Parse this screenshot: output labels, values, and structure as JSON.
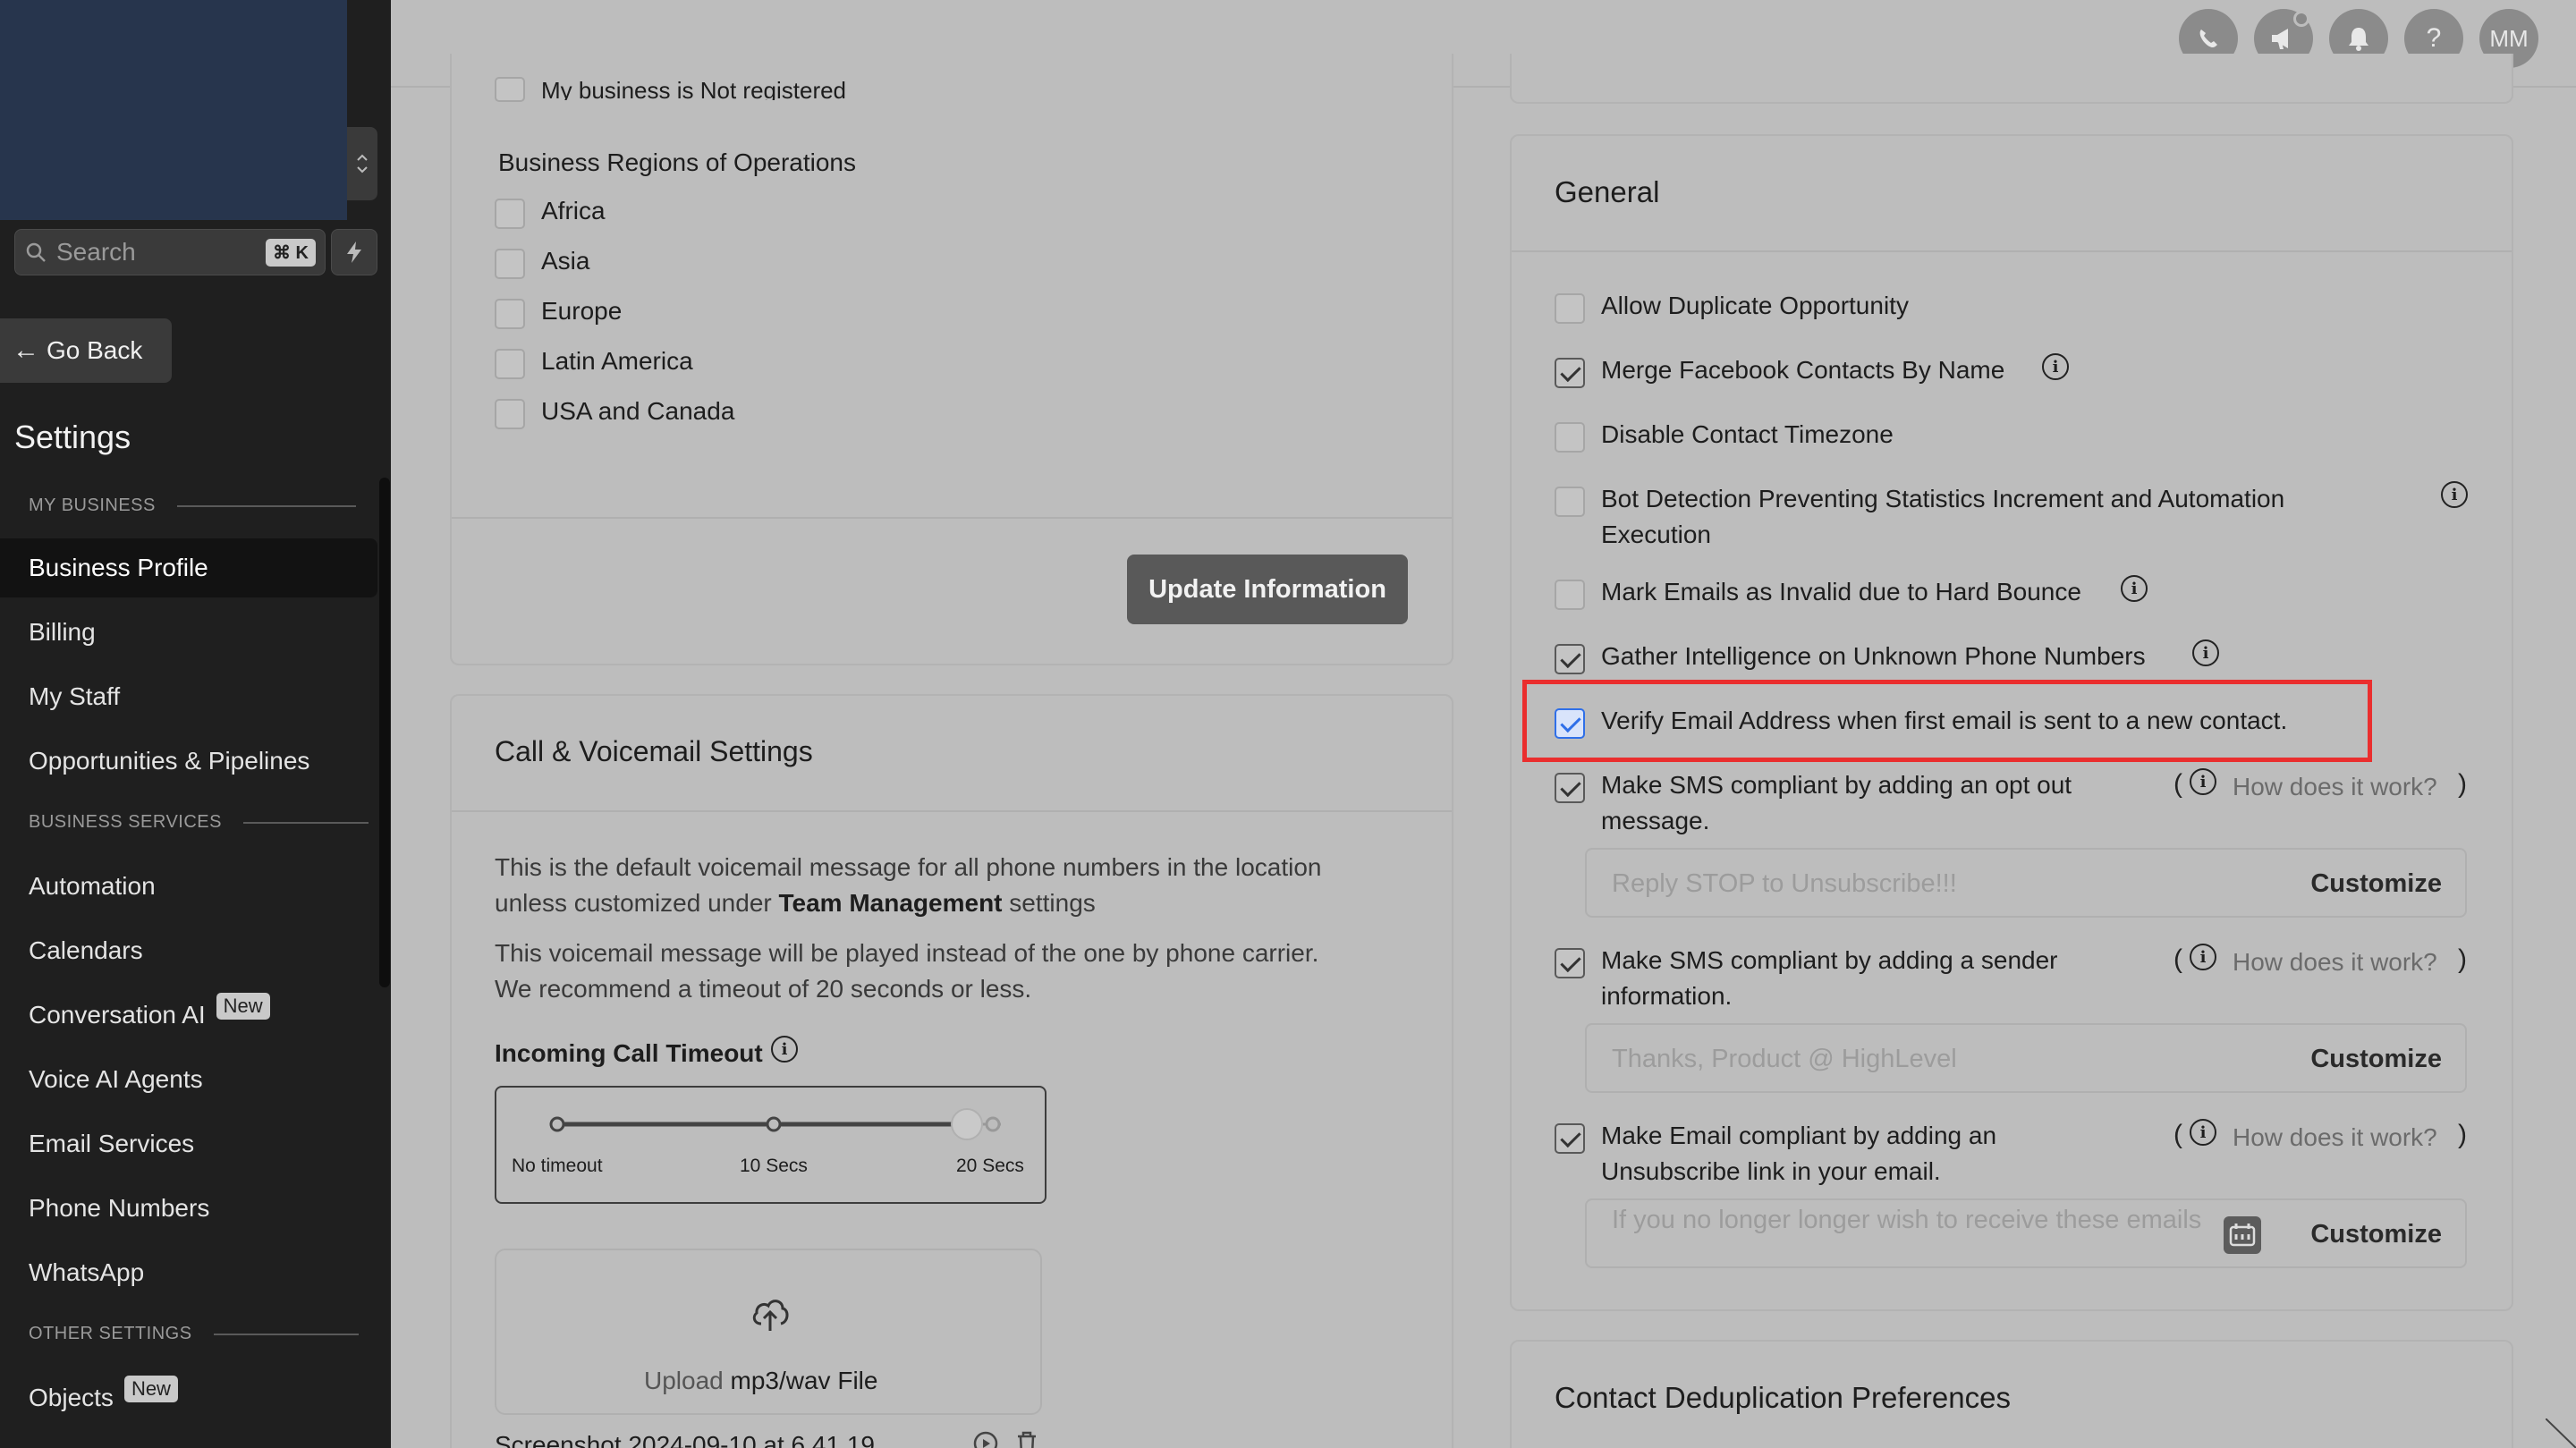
{
  "sidebar": {
    "search_placeholder": "Search",
    "search_shortcut": "⌘ K",
    "go_back": "Go Back",
    "title": "Settings",
    "sections": {
      "my_business": "MY BUSINESS",
      "business_services": "BUSINESS SERVICES",
      "other_settings": "OTHER SETTINGS"
    },
    "items": [
      {
        "label": "Business Profile"
      },
      {
        "label": "Billing"
      },
      {
        "label": "My Staff"
      },
      {
        "label": "Opportunities & Pipelines"
      },
      {
        "label": "Automation"
      },
      {
        "label": "Calendars"
      },
      {
        "label": "Conversation AI",
        "badge": "New"
      },
      {
        "label": "Voice AI Agents"
      },
      {
        "label": "Email Services"
      },
      {
        "label": "Phone Numbers"
      },
      {
        "label": "WhatsApp"
      },
      {
        "label": "Objects",
        "badge": "New"
      }
    ]
  },
  "topbar": {
    "avatar_initials": "MM",
    "help": "?"
  },
  "left_card": {
    "partial_checkbox": "My business is Not registered",
    "regions_title": "Business Regions of Operations",
    "regions": [
      "Africa",
      "Asia",
      "Europe",
      "Latin America",
      "USA and Canada"
    ],
    "update_button": "Update Information"
  },
  "call_card": {
    "title": "Call & Voicemail Settings",
    "desc1_line1": "This is the default voicemail message for all phone numbers in the location",
    "desc1_line2_pre": "unless customized under ",
    "desc1_line2_bold": "Team Management",
    "desc1_line2_post": " settings",
    "desc2_line1": "This voicemail message will be played instead of the one by phone carrier.",
    "desc2_line2": "We recommend a timeout of 20 seconds or less.",
    "timeout_label": "Incoming Call Timeout",
    "slider_labels": [
      "No timeout",
      "10 Secs",
      "20 Secs"
    ],
    "slider_value_fraction": 0.9,
    "upload_pre": "Upload ",
    "upload_bold": "mp3/wav File",
    "file_name": "Screenshot 2024-09-10 at 6.41.19"
  },
  "general": {
    "title": "General",
    "options": [
      {
        "label": "Allow Duplicate Opportunity",
        "checked": false
      },
      {
        "label": "Merge Facebook Contacts By Name",
        "checked": true
      },
      {
        "label": "Disable Contact Timezone",
        "checked": false
      },
      {
        "label_line1": "Bot Detection Preventing Statistics Increment and Automation",
        "label_line2": "Execution",
        "checked": false
      },
      {
        "label": "Mark Emails as Invalid due to Hard Bounce",
        "checked": false
      },
      {
        "label": "Gather Intelligence on Unknown Phone Numbers",
        "checked": true
      },
      {
        "label": "Verify Email Address when first email is sent to a new contact.",
        "checked": true
      },
      {
        "label_line1": "Make SMS compliant by adding an opt out",
        "label_line2": "message.",
        "checked": true
      },
      {
        "label_line1": "Make SMS compliant by adding a sender",
        "label_line2": "information.",
        "checked": true
      },
      {
        "label_line1": "Make Email compliant by adding an",
        "label_line2": "Unsubscribe link in your email.",
        "checked": true
      }
    ],
    "how_link": "How does it work?",
    "paren_open": "(",
    "paren_close": ")",
    "fields": [
      {
        "placeholder": "Reply STOP to Unsubscribe!!!",
        "button": "Customize"
      },
      {
        "placeholder": "Thanks, Product @ HighLevel",
        "button": "Customize"
      },
      {
        "placeholder": "If you no longer longer wish to receive these emails",
        "button": "Customize"
      }
    ]
  },
  "dedup": {
    "title": "Contact Deduplication Preferences"
  },
  "colors": {
    "highlight": "#ea2e2e",
    "checkbox_blue": "#2f6fe8",
    "sidebar_bg": "#1f1f1f"
  }
}
